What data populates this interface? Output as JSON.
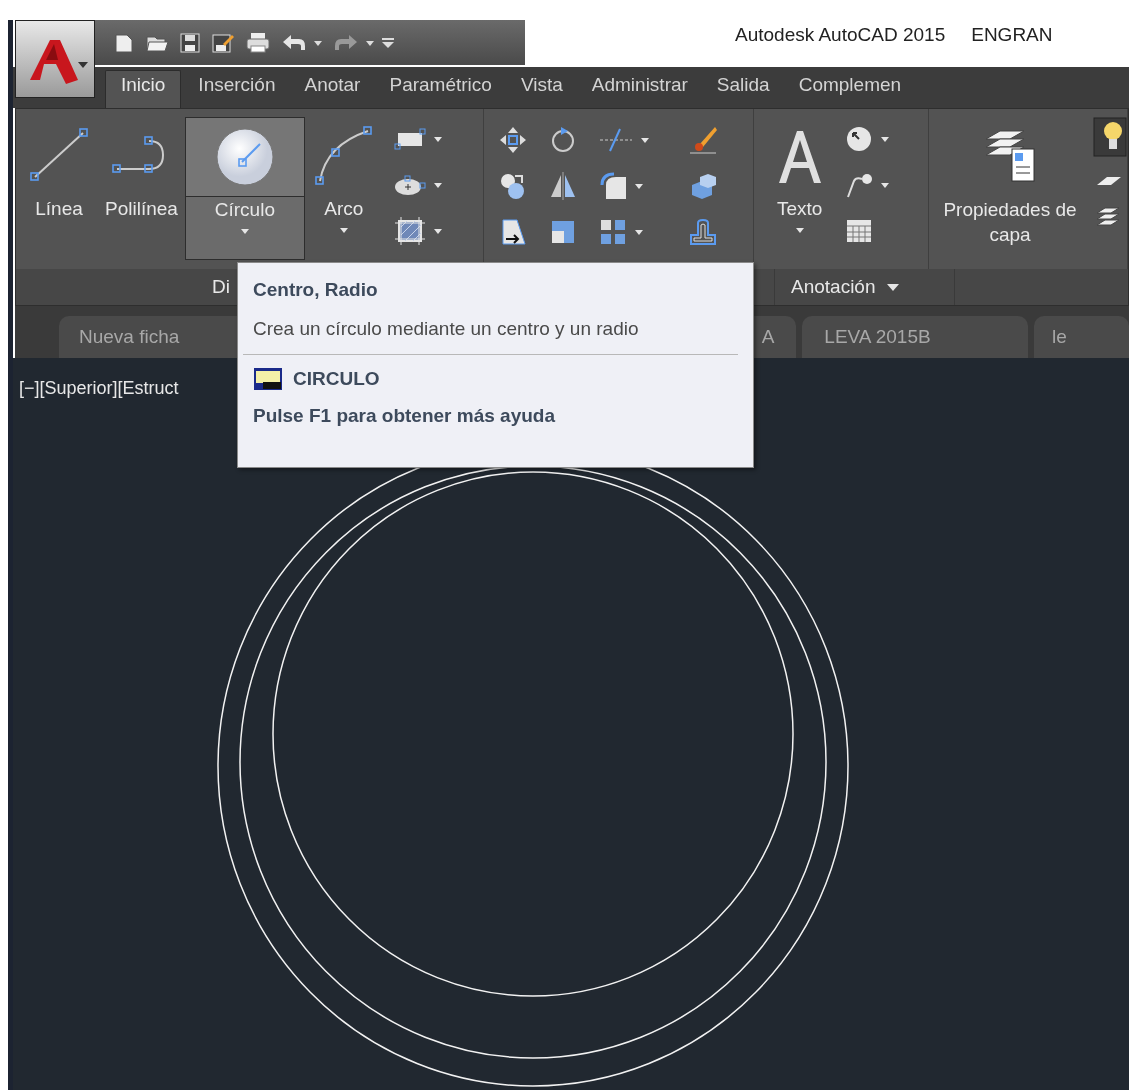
{
  "window": {
    "title": "Autodesk AutoCAD 2015",
    "document": "ENGRAN"
  },
  "ribbon_tabs": [
    {
      "label": "Inicio",
      "selected": true
    },
    {
      "label": "Inserción",
      "selected": false
    },
    {
      "label": "Anotar",
      "selected": false
    },
    {
      "label": "Paramétrico",
      "selected": false
    },
    {
      "label": "Vista",
      "selected": false
    },
    {
      "label": "Administrar",
      "selected": false
    },
    {
      "label": "Salida",
      "selected": false
    },
    {
      "label": "Complemen",
      "selected": false
    }
  ],
  "draw_panel": {
    "label": "Di",
    "tools": [
      {
        "label": "Línea",
        "kind": "line",
        "highlighted": false,
        "dropdown": false
      },
      {
        "label": "Polilínea",
        "kind": "polyline",
        "highlighted": false,
        "dropdown": false
      },
      {
        "label": "Círculo",
        "kind": "circle",
        "highlighted": true,
        "dropdown": true
      },
      {
        "label": "Arco",
        "kind": "arc",
        "highlighted": false,
        "dropdown": true
      }
    ]
  },
  "annotation_panel": {
    "label": "Anotación",
    "tool": "Texto"
  },
  "layers_panel": {
    "tool": "Propiedades de capa"
  },
  "file_tabs": [
    {
      "label": "Nueva ficha"
    },
    {
      "label": "A"
    },
    {
      "label": "LEVA 2015B"
    },
    {
      "label": "le"
    }
  ],
  "viewport": {
    "label": "[−][Superior][Estruct"
  },
  "tooltip": {
    "title": "Centro, Radio",
    "description": "Crea un círculo mediante un centro y un radio",
    "command": "CIRCULO",
    "help": "Pulse F1 para obtener más ayuda"
  }
}
